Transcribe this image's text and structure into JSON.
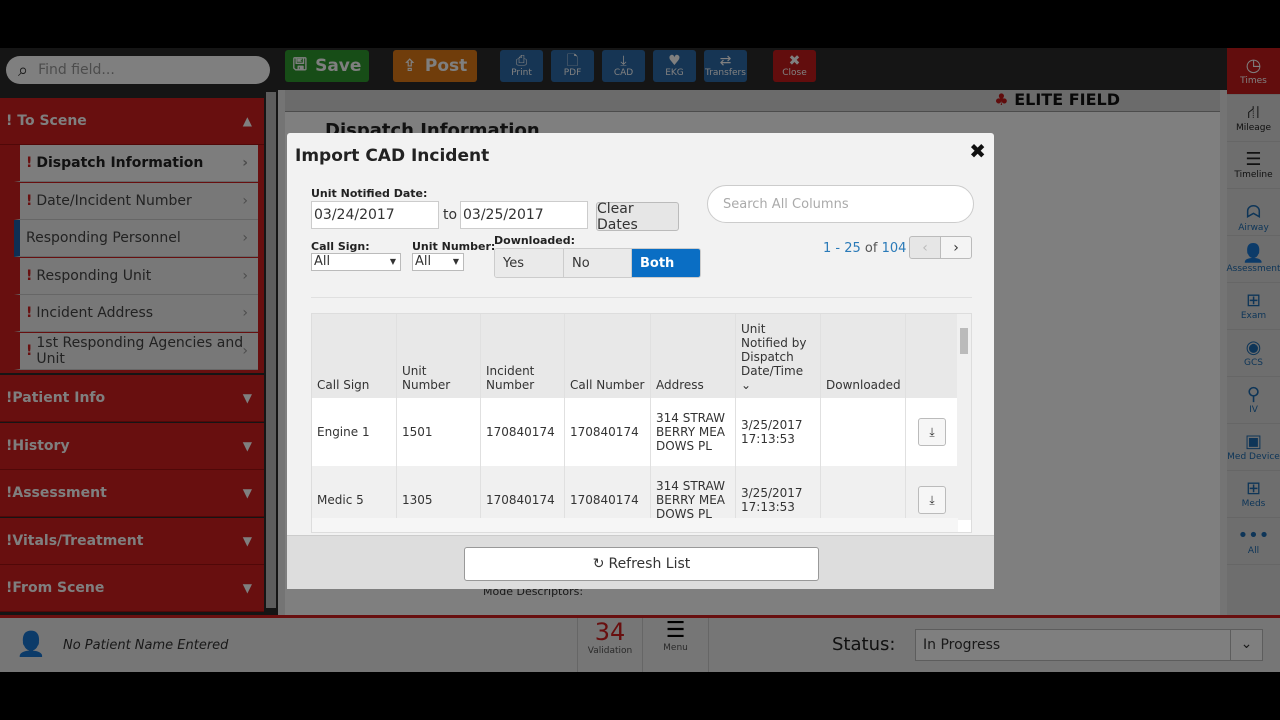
{
  "sidebar": {
    "search_placeholder": "Find field...",
    "sections": [
      {
        "label": "To Scene"
      },
      {
        "label": "Patient Info"
      },
      {
        "label": "History"
      },
      {
        "label": "Assessment"
      },
      {
        "label": "Vitals/Treatment"
      },
      {
        "label": "From Scene"
      }
    ],
    "subitems": [
      {
        "label": "Dispatch Information",
        "required": true
      },
      {
        "label": "Date/Incident Number",
        "required": true
      },
      {
        "label": "Responding Personnel",
        "required": false
      },
      {
        "label": "Responding Unit",
        "required": true
      },
      {
        "label": "Incident Address",
        "required": true
      },
      {
        "label": "1st Responding Agencies and Unit",
        "required": true
      }
    ]
  },
  "toolbar": {
    "save": "Save",
    "post": "Post",
    "print": "Print",
    "pdf": "PDF",
    "cad": "CAD",
    "ekg": "EKG",
    "transfers": "Transfers",
    "close": "Close"
  },
  "brand": "ELITE FIELD",
  "main": {
    "title": "Dispatch Information",
    "mode_label": "Mode Descriptors:"
  },
  "rail": [
    "Times",
    "Mileage",
    "Timeline",
    "Airway",
    "Assessment",
    "Exam",
    "GCS",
    "IV",
    "Med Device",
    "Meds",
    "All"
  ],
  "footer": {
    "patient": "No Patient Name Entered",
    "validation_count": "34",
    "validation_label": "Validation",
    "menu_label": "Menu",
    "status_label": "Status:",
    "status_value": "In Progress"
  },
  "modal": {
    "title": "Import CAD Incident",
    "date_label": "Unit Notified Date:",
    "date_from": "03/24/2017",
    "to": "to",
    "date_to": "03/25/2017",
    "clear": "Clear Dates",
    "search_placeholder": "Search All Columns",
    "callsign_label": "Call Sign:",
    "callsign_value": "All",
    "unitnum_label": "Unit Number:",
    "unitnum_value": "All",
    "downloaded_label": "Downloaded:",
    "downloaded_options": [
      "Yes",
      "No",
      "Both"
    ],
    "downloaded_selected": "Both",
    "paging": {
      "range": "1 - 25",
      "of": "of",
      "total": "104"
    },
    "columns": [
      "Call Sign",
      "Unit Number",
      "Incident Number",
      "Call Number",
      "Address",
      "Unit Notified by Dispatch Date/Time",
      "Downloaded"
    ],
    "rows": [
      {
        "call_sign": "Engine 1",
        "unit": "1501",
        "incident": "170840174",
        "call": "170840174",
        "address": "314 STRAWBERRY MEADOWS PL",
        "datetime": "3/25/2017 17:13:53"
      },
      {
        "call_sign": "Medic 5",
        "unit": "1305",
        "incident": "170840174",
        "call": "170840174",
        "address": "314 STRAWBERRY MEADOWS PL",
        "datetime": "3/25/2017 17:13:53"
      }
    ],
    "refresh": "Refresh List"
  },
  "colors": {
    "red": "#d01e1e",
    "blue": "#0a6ec4",
    "save": "#2e9a2e",
    "post": "#e07b17"
  }
}
